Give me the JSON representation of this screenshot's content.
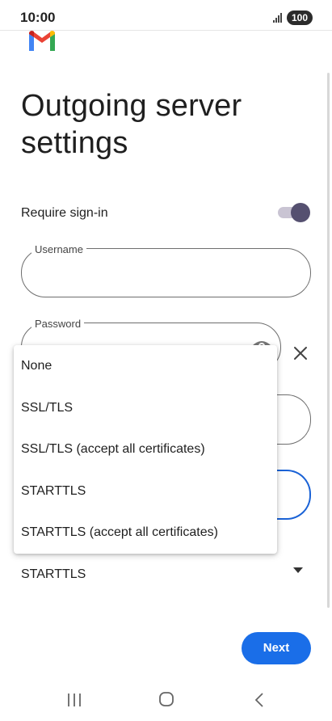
{
  "status_bar": {
    "time": "10:00",
    "battery": "100"
  },
  "header": {
    "logo": "gmail-logo",
    "title": "Outgoing server settings"
  },
  "form": {
    "require_signin_label": "Require sign-in",
    "require_signin_on": true,
    "username": {
      "label": "Username",
      "value": ""
    },
    "password": {
      "label": "Password",
      "value": ""
    },
    "security_type_value": "STARTTLS"
  },
  "dropdown": {
    "options": [
      "None",
      "SSL/TLS",
      "SSL/TLS (accept all certificates)",
      "STARTTLS",
      "STARTTLS (accept all certificates)"
    ]
  },
  "actions": {
    "next_label": "Next"
  },
  "colors": {
    "accent": "#1a6ee8",
    "toggle_thumb": "#555070",
    "toggle_track": "#c9c4d3",
    "focus_border": "#1a62d6"
  },
  "icons": {
    "password_visibility": "eye-icon",
    "clear": "close-icon",
    "nav_recents": "recents-icon",
    "nav_home": "home-icon",
    "nav_back": "back-icon"
  }
}
